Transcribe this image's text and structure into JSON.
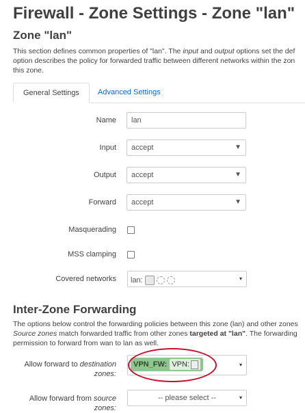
{
  "page": {
    "title": "Firewall - Zone Settings - Zone \"lan\"",
    "zone_heading": "Zone \"lan\"",
    "desc1": {
      "line1_pre": "This section defines common properties of \"lan\". The ",
      "line1_input": "input",
      "line1_mid": " and ",
      "line1_output": "output",
      "line1_post": " options set the def",
      "line2": "option describes the policy for forwarded traffic between different networks within the zon",
      "line3": "this zone."
    }
  },
  "tabs": [
    {
      "label": "General Settings",
      "active": true
    },
    {
      "label": "Advanced Settings",
      "active": false
    }
  ],
  "form": {
    "name": {
      "label": "Name",
      "value": "lan"
    },
    "input": {
      "label": "Input",
      "value": "accept",
      "arrow": "▼"
    },
    "output": {
      "label": "Output",
      "value": "accept",
      "arrow": "▼"
    },
    "forward": {
      "label": "Forward",
      "value": "accept",
      "arrow": "▼"
    },
    "masquerading": {
      "label": "Masquerading",
      "checked": false
    },
    "mss_clamping": {
      "label": "MSS clamping",
      "checked": false
    },
    "covered_networks": {
      "label": "Covered networks",
      "value": "lan:",
      "caret": "▾"
    }
  },
  "forwarding": {
    "heading": "Inter-Zone Forwarding",
    "desc": {
      "line1": "The options below control the forwarding policies between this zone (lan) and other zones",
      "line2_a": "Source zones",
      "line2_b": " match forwarded traffic from other zones ",
      "line2_c": "targeted at \"lan\"",
      "line2_d": ". The forwarding",
      "line3": "permission to forward from wan to lan as well."
    },
    "dest": {
      "label_a": "Allow forward to ",
      "label_b": "destination",
      "label_c": "zones:",
      "zone": "VPN_FW:",
      "network": "VPN:",
      "caret": "▾"
    },
    "src": {
      "label_a": "Allow forward from ",
      "label_b": "source",
      "label_c": "zones:",
      "placeholder": "-- please select --",
      "caret": "▾"
    }
  },
  "colors": {
    "link": "#0069d6",
    "annotation": "#c8102e",
    "badge": "#90c590"
  }
}
